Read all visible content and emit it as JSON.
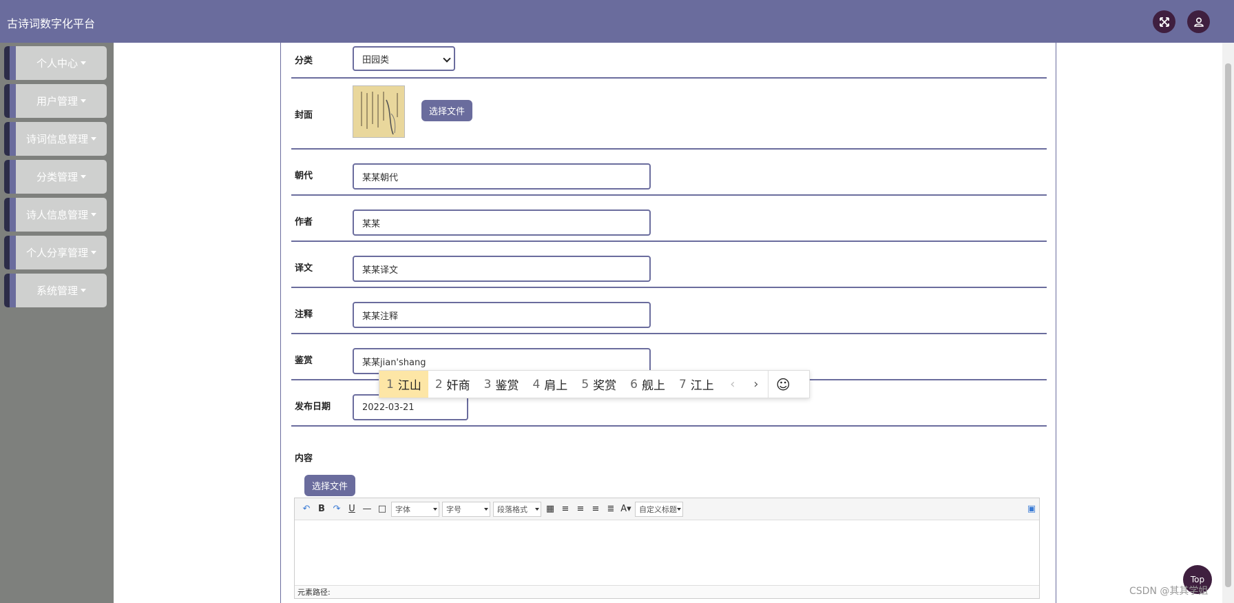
{
  "app": {
    "title": "古诗词数字化平台"
  },
  "header": {
    "fullscreen_icon": "fullscreen-icon",
    "user_icon": "user-icon"
  },
  "sidebar": {
    "items": [
      {
        "label": "个人中心"
      },
      {
        "label": "用户管理"
      },
      {
        "label": "诗词信息管理"
      },
      {
        "label": "分类管理"
      },
      {
        "label": "诗人信息管理"
      },
      {
        "label": "个人分享管理"
      },
      {
        "label": "系统管理"
      }
    ]
  },
  "form": {
    "category": {
      "label": "分类",
      "value": "田园类"
    },
    "cover": {
      "label": "封面",
      "button": "选择文件"
    },
    "dynasty": {
      "label": "朝代",
      "value": "某某朝代"
    },
    "author": {
      "label": "作者",
      "value": "某某"
    },
    "translation": {
      "label": "译文",
      "value": "某某译文"
    },
    "notes": {
      "label": "注释",
      "value": "某某注释"
    },
    "appreciation": {
      "label": "鉴赏",
      "value": "某某jian'shang"
    },
    "publish_date": {
      "label": "发布日期",
      "value": "2022-03-21"
    },
    "content": {
      "label": "内容",
      "button": "选择文件"
    }
  },
  "ime": {
    "candidates": [
      {
        "n": "1",
        "text": "江山"
      },
      {
        "n": "2",
        "text": "奸商"
      },
      {
        "n": "3",
        "text": "鉴赏"
      },
      {
        "n": "4",
        "text": "肩上"
      },
      {
        "n": "5",
        "text": "奖赏"
      },
      {
        "n": "6",
        "text": "舰上"
      },
      {
        "n": "7",
        "text": "江上"
      }
    ],
    "prev": "‹",
    "next": "›",
    "emoji": "☺"
  },
  "editor": {
    "font_select": "字体",
    "size_select": "字号",
    "paragraph_select": "段落格式",
    "custom_title_select": "自定义标题",
    "status": "元素路径:"
  },
  "top_button": "Top",
  "watermark": "CSDN @其其学姐"
}
